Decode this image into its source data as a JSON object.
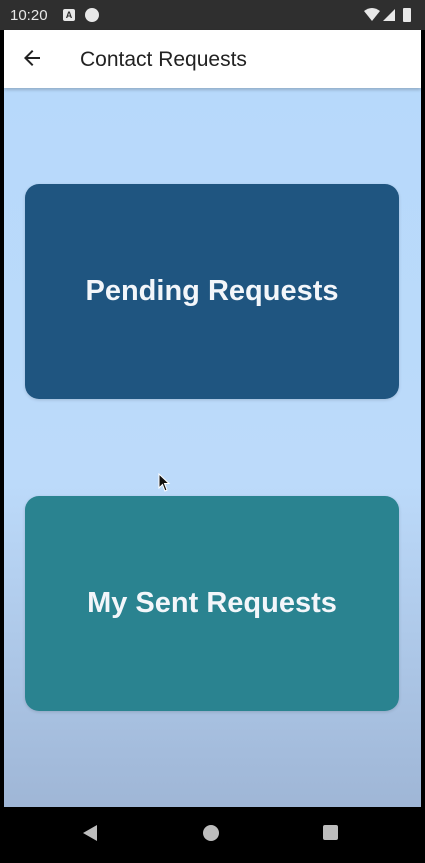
{
  "status_bar": {
    "time": "10:20",
    "icons": [
      "notification-a-icon",
      "notification-app-icon",
      "wifi-icon",
      "cellular-signal-icon",
      "battery-icon"
    ]
  },
  "app_bar": {
    "back_icon": "arrow-back-icon",
    "title": "Contact Requests",
    "background": "#ffffff"
  },
  "main": {
    "cards": [
      {
        "label": "Pending Requests",
        "color": "#1f5580"
      },
      {
        "label": "My Sent Requests",
        "color": "#2a8390"
      }
    ],
    "background_gradient": [
      "#b7d9fb",
      "#9fb6d6"
    ]
  },
  "nav_bar": {
    "icons": [
      "nav-back-icon",
      "nav-home-icon",
      "nav-recents-icon"
    ]
  }
}
